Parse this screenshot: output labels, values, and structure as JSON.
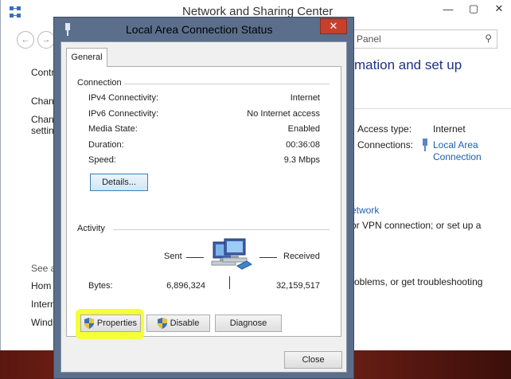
{
  "background_window": {
    "title": "Network and Sharing Center",
    "controls": [
      "—",
      "▢",
      "✕"
    ],
    "search_placeholder": "Panel",
    "heading": "mation and set up",
    "sidebar": {
      "item1": "Contr",
      "item2": "Chan",
      "item3a": "Chan",
      "item3b": "settin",
      "see_also": "See a",
      "link1": "Hom",
      "link2": "Intern",
      "link3": "Wind"
    },
    "access_type_label": "Access type:",
    "access_type_value": "Internet",
    "connections_label": "Connections:",
    "connection_link_line1": "Local Area",
    "connection_link_line2": "Connection",
    "network_link": "etwork",
    "vpn_text": "or VPN connection; or set up a",
    "troubleshoot_text": "roblems, or get troubleshooting"
  },
  "dialog": {
    "title": "Local Area Connection Status",
    "close_label": "✕",
    "tab_general": "General",
    "connection_group": "Connection",
    "rows": [
      {
        "label": "IPv4 Connectivity:",
        "value": "Internet"
      },
      {
        "label": "IPv6 Connectivity:",
        "value": "No Internet access"
      },
      {
        "label": "Media State:",
        "value": "Enabled"
      },
      {
        "label": "Duration:",
        "value": "00:36:08"
      },
      {
        "label": "Speed:",
        "value": "9.3 Mbps"
      }
    ],
    "details_button": "Details...",
    "activity_group": "Activity",
    "sent_label": "Sent",
    "received_label": "Received",
    "bytes_label": "Bytes:",
    "bytes_sent": "6,896,324",
    "bytes_received": "32,159,517",
    "properties_button": "Properties",
    "disable_button": "Disable",
    "diagnose_button": "Diagnose",
    "close_button": "Close"
  },
  "colors": {
    "accent_link": "#1a5fb4",
    "highlight": "#f4ff3a",
    "close_red": "#c7402c"
  }
}
